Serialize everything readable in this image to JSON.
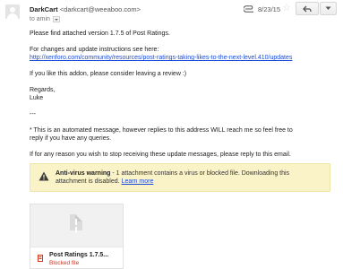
{
  "header": {
    "sender_name": "DarkCart",
    "sender_email": "<darkcart@weeaboo.com>",
    "to_label": "to amin",
    "date": "8/23/15"
  },
  "body": {
    "line1": "Please find attached version 1.7.5 of Post Ratings.",
    "line2": "For changes and update instructions see here:",
    "link": "http://xenforo.com/community/resources/post-ratings-taking-likes-to-the-next-level.410/updates",
    "line3": "If you like this addon, please consider leaving a review :)",
    "regards": "Regards,",
    "signature": "Luke",
    "separator": "---",
    "auto_line1": "* This is an automated message, however replies to this address WILL reach me so feel free to",
    "auto_line2": "reply if you have any queries.",
    "unsubscribe_line": "If for any reason you wish to stop receiving these update messages, please reply to this email."
  },
  "warning": {
    "title": "Anti-virus warning",
    "text_part1": " - 1 attachment contains a virus or blocked file. Downloading this",
    "text_part2": "attachment is disabled. ",
    "learn_more": "Learn more"
  },
  "attachment": {
    "name": "Post Ratings 1.7.5...",
    "status": "Blocked file"
  },
  "icons": {
    "attach": "paperclip-icon",
    "star": "star-icon",
    "reply": "reply-icon",
    "more": "chevron-down-icon",
    "warning": "warning-triangle-icon",
    "file": "file-icon",
    "blocked": "blocked-file-icon"
  },
  "colors": {
    "link": "#1a4bd8",
    "warning_bg": "#fbf3c8",
    "blocked_text": "#d9321f"
  }
}
